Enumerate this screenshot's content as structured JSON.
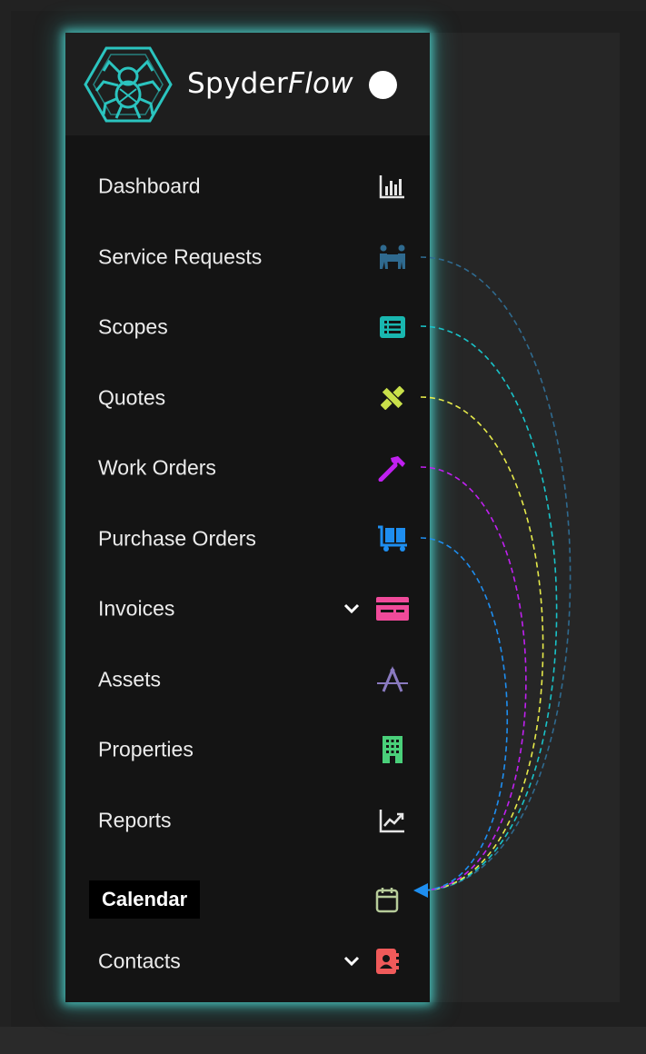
{
  "app": {
    "brand_prefix": "Spyder",
    "brand_suffix": "Flow"
  },
  "menu": {
    "items": [
      {
        "label": "Dashboard",
        "icon": "bar-chart-icon",
        "color": "#e6e6e6"
      },
      {
        "label": "Service Requests",
        "icon": "people-carry-icon",
        "color": "#2f6a8f"
      },
      {
        "label": "Scopes",
        "icon": "list-icon",
        "color": "#19b7b0"
      },
      {
        "label": "Quotes",
        "icon": "pencil-ruler-icon",
        "color": "#c9e04a"
      },
      {
        "label": "Work Orders",
        "icon": "hammer-icon",
        "color": "#c020f0"
      },
      {
        "label": "Purchase Orders",
        "icon": "dolly-icon",
        "color": "#1e8ef0"
      },
      {
        "label": "Invoices",
        "icon": "invoice-icon",
        "color": "#f04a9a"
      },
      {
        "label": "Assets",
        "icon": "compass-icon",
        "color": "#8a7ac0"
      },
      {
        "label": "Properties",
        "icon": "building-icon",
        "color": "#4ad07a"
      },
      {
        "label": "Reports",
        "icon": "chart-line-icon",
        "color": "#e6e6e6"
      },
      {
        "label": "Calendar",
        "icon": "calendar-icon",
        "color": "#b7cc9a"
      },
      {
        "label": "Contacts",
        "icon": "address-book-icon",
        "color": "#f05a5a"
      }
    ]
  },
  "connectors": {
    "colors": [
      "#2f6a8f",
      "#19c2c8",
      "#e6ea4a",
      "#c020f0",
      "#1e8ef0"
    ],
    "arrow_color": "#1e8ef0"
  }
}
